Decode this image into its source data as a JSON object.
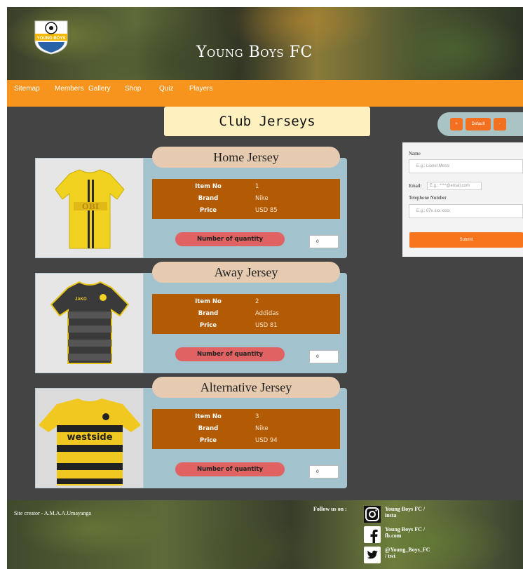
{
  "header": {
    "title": "Young Boys FC",
    "logo_text": "YOUNG BOYS"
  },
  "nav": {
    "items": [
      "Sitemap",
      "Members",
      "Gallery",
      "Shop",
      "Quiz",
      "Players"
    ]
  },
  "page_heading": "Club Jerseys",
  "controls": {
    "plus_label": "+",
    "default_label": "Default",
    "minus_label": "-"
  },
  "form": {
    "name_label": "Name",
    "name_placeholder": "E.g.: Lionel Messi",
    "email_label": "Email:",
    "email_placeholder": "E.g.: ****@email.com",
    "phone_label": "Telephone Number",
    "phone_placeholder": "E.g.: 07x xxx xxxx",
    "submit_label": "Submit"
  },
  "jerseys": [
    {
      "title": "Home Jersey",
      "item_no_label": "Item No",
      "item_no": "1",
      "brand_label": "Brand",
      "brand": "Nike",
      "price_label": "Price",
      "price": "USD 85",
      "qty_label": "Number of quantity",
      "qty_value": "0",
      "shirt_text": "OBI"
    },
    {
      "title": "Away Jersey",
      "item_no_label": "Item No",
      "item_no": "2",
      "brand_label": "Brand",
      "brand": "Addidas",
      "price_label": "Price",
      "price": "USD 81",
      "qty_label": "Number of quantity",
      "qty_value": "0",
      "shirt_text": "JAKO"
    },
    {
      "title": "Alternative Jersey",
      "item_no_label": "Item No",
      "item_no": "3",
      "brand_label": "Brand",
      "brand": "Nike",
      "price_label": "Price",
      "price": "USD 94",
      "qty_label": "Number of quantity",
      "qty_value": "0",
      "shirt_text": "westside"
    }
  ],
  "footer": {
    "creator": "Site creator - A.M.A.A.Umayanga",
    "follow_label": "Follow us on :",
    "social": [
      {
        "icon": "instagram-icon",
        "line1": "Young Boys FC /",
        "line2": "insta"
      },
      {
        "icon": "facebook-icon",
        "line1": "Young Boys FC /",
        "line2": "fb.com"
      },
      {
        "icon": "twitter-icon",
        "line1": "@Young_Boys_FC",
        "line2": "/ twi"
      }
    ]
  },
  "colors": {
    "accent": "#f7941d",
    "panel": "#a2c3cd",
    "info": "#b35a05",
    "title_pill": "#e6cbb0",
    "qty_button": "#e06262"
  }
}
